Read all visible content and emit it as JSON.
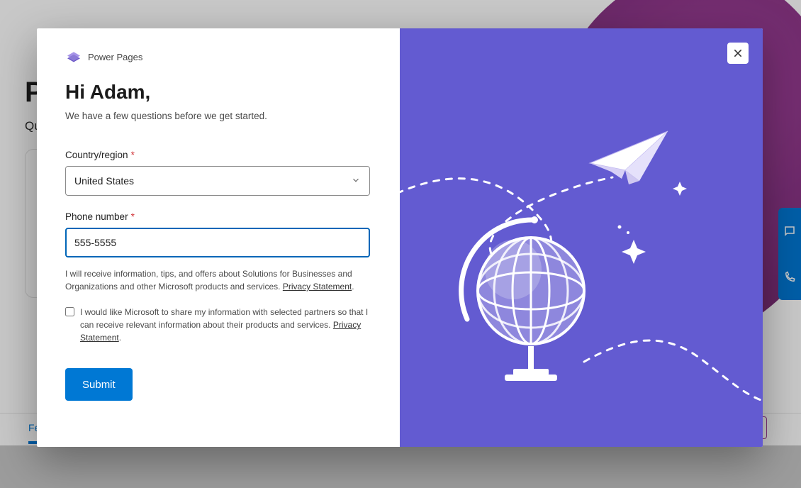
{
  "background": {
    "heading_fragment": "P",
    "subtitle_fragment": "Qu",
    "tab_fragment": "Fe"
  },
  "support_panel": {
    "item1": "chat",
    "item2": "call"
  },
  "brand": {
    "name": "Power Pages"
  },
  "greeting": "Hi Adam,",
  "intro": "We have a few questions before we get started.",
  "form": {
    "country": {
      "label": "Country/region",
      "required_mark": "*",
      "value": "United States"
    },
    "phone": {
      "label": "Phone number",
      "required_mark": "*",
      "value": "555-5555"
    },
    "disclosure_pre": "I will receive information, tips, and offers about Solutions for Businesses and Organizations and other Microsoft products and services. ",
    "privacy_link": "Privacy Statement",
    "consent_pre": "I would like Microsoft to share my information with selected partners so that I can receive relevant information about their products and services. ",
    "submit_label": "Submit"
  },
  "close_label": "Close"
}
